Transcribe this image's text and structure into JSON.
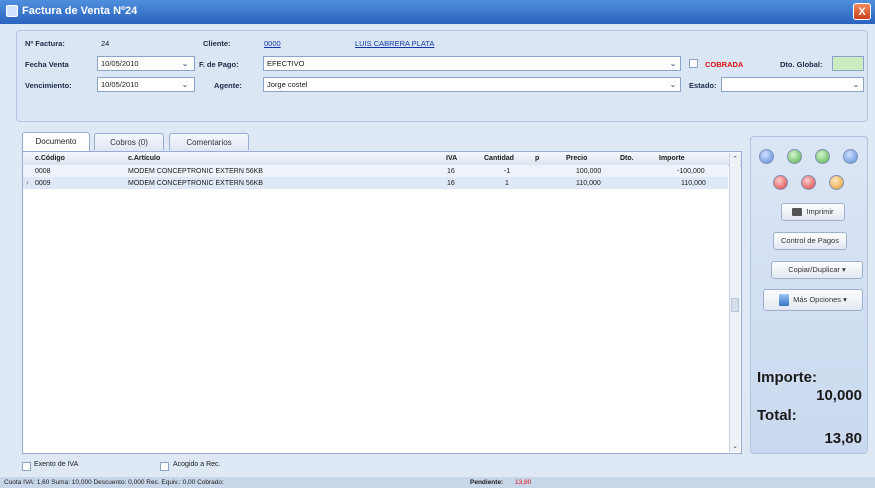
{
  "window": {
    "title": "Factura de Venta Nº24",
    "close": "X"
  },
  "header": {
    "factura_label": "Nº Factura:",
    "factura_value": "24",
    "cliente_label": "Cliente:",
    "cliente_code": "0000",
    "cliente_name": "LUIS CABRERA PLATA",
    "fecha_venta_label": "Fecha Venta",
    "fecha_venta_value": "10/05/2010",
    "fpago_label": "F. de Pago:",
    "fpago_value": "EFECTIVO",
    "cobrada_label": "COBRADA",
    "dto_global_label": "Dto. Global:",
    "dto_global_value": "",
    "vencimiento_label": "Vencimiento:",
    "vencimiento_value": "10/05/2010",
    "agente_label": "Agente:",
    "agente_value": "Jorge costel",
    "estado_label": "Estado:",
    "estado_value": ""
  },
  "tabs": [
    "Documento",
    "Cobros (0)",
    "Comentarios"
  ],
  "grid": {
    "columns": [
      "c.Código",
      "c.Artículo",
      "IVA",
      "Cantidad",
      "p",
      "Precio",
      "Dto.",
      "Importe"
    ],
    "rows": [
      {
        "codigo": "0008",
        "articulo": "MODEM CONCEPTRONIC EXTERN 56KB",
        "iva": "16",
        "cantidad": "-1",
        "precio": "100,000",
        "dto": "",
        "importe": "-100,000"
      },
      {
        "codigo": "0009",
        "articulo": "MODEM CONCEPTRONIC EXTERN 56KB",
        "iva": "16",
        "cantidad": "1",
        "precio": "110,000",
        "dto": "",
        "importe": "110,000"
      }
    ]
  },
  "rightpanel": {
    "imprimir_label": "Imprimir",
    "control_pagos_label": "Control de Pagos",
    "copiar_label": "Copiar/Duplicar",
    "mas_opciones_label": "Más Opciones",
    "importe_label": "Importe:",
    "importe_value": "10,000",
    "total_label": "Total:",
    "total_value": "13,80"
  },
  "footer": {
    "exento_label": "Exento de IVA",
    "acogido_label": "Acogido a Rec."
  },
  "statusbar": {
    "left": "Cuota IVA: 1,60 Suma: 10,000 Descuento: 0,000 Rec. Equiv.: 0,00 Cobrado:",
    "pendiente_label": "Pendiente:",
    "pendiente_value": "13,80"
  },
  "colors": {
    "title_bar": "#2a63bf",
    "accent_red": "#d11",
    "dto_green": "#c9ecc0"
  }
}
